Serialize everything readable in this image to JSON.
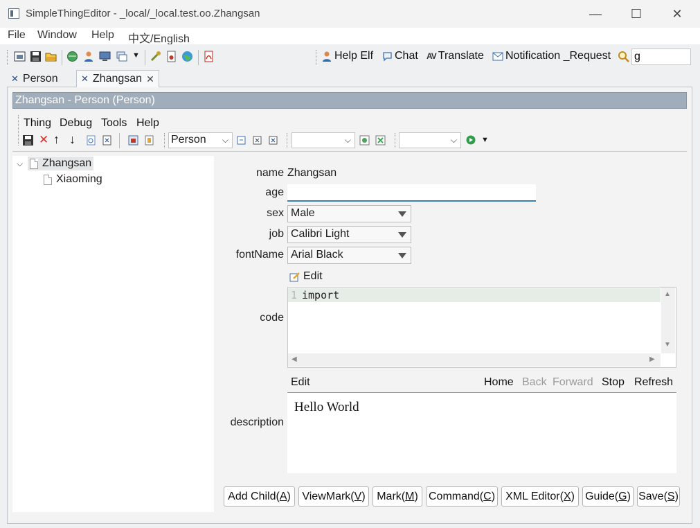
{
  "window": {
    "title": "SimpleThingEditor - _local/_local.test.oo.Zhangsan",
    "controls": [
      "—",
      "☐",
      "✕"
    ]
  },
  "menubar": {
    "items": [
      "File",
      "Window",
      "Help",
      "中文/English"
    ]
  },
  "toolbar": {
    "help_elf": "Help Elf",
    "chat": "Chat",
    "translate": "Translate",
    "notification": "Notification _Request",
    "search_value": "g"
  },
  "tabs": [
    {
      "label": "Person"
    },
    {
      "label": "Zhangsan"
    }
  ],
  "editor": {
    "header": "Zhangsan - Person  (Person)",
    "menu": [
      "Thing",
      "Debug",
      "Tools",
      "Help"
    ],
    "descriptor_combo": "Person"
  },
  "tree": {
    "root": "Zhangsan",
    "child": "Xiaoming"
  },
  "form": {
    "name_label": "name",
    "name_value": "Zhangsan",
    "age_label": "age",
    "age_value": "",
    "sex_label": "sex",
    "sex_value": "Male",
    "job_label": "job",
    "job_value": "Calibri Light",
    "fontname_label": "fontName",
    "fontname_value": "Arial Black",
    "code_edit": "Edit",
    "code_label": "code",
    "code_line_no": "1",
    "code_text": "import",
    "description_label": "description",
    "description_edit": "Edit",
    "description_text": "Hello World",
    "browser_links": {
      "home": "Home",
      "back": "Back",
      "forward": "Forward",
      "stop": "Stop",
      "refresh": "Refresh"
    }
  },
  "buttons": {
    "add_child": "Add Child(",
    "add_child_key": "A",
    "viewmark": "ViewMark(",
    "viewmark_key": "V",
    "mark": "Mark(",
    "mark_key": "M",
    "command": "Command(",
    "command_key": "C",
    "xml_editor": "XML Editor(",
    "xml_editor_key": "X",
    "guide": "Guide(",
    "guide_key": "G",
    "save": "Save(",
    "save_key": "S",
    "close_paren": ")"
  },
  "colors": {
    "header_bg": "#a0adbb",
    "focus_underline": "#3b7fb0",
    "disabled_link": "#9a9a9a"
  }
}
